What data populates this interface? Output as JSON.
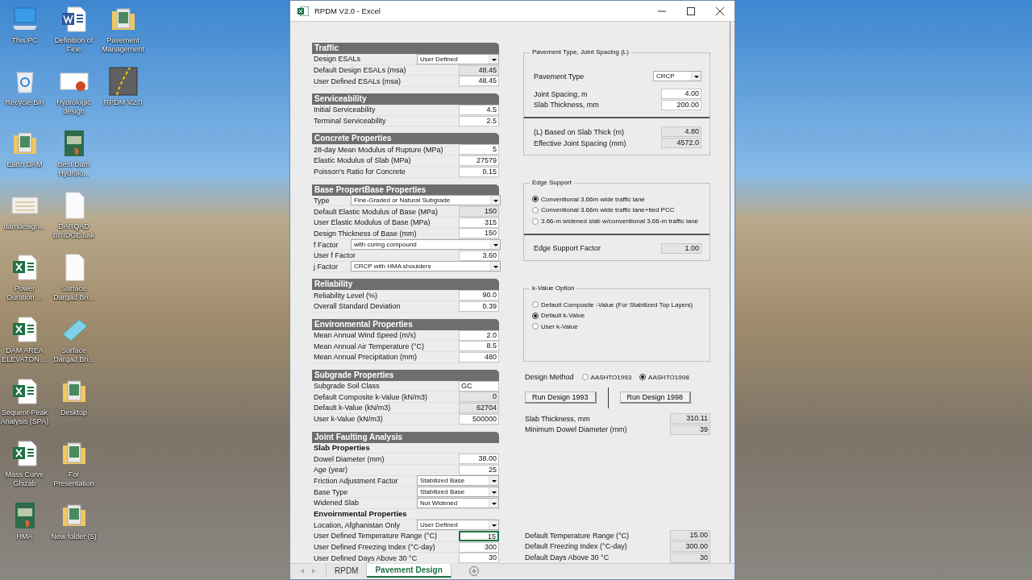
{
  "desktop": {
    "icons": [
      {
        "label": "This PC",
        "kind": "computer"
      },
      {
        "label": "Recycle Bin",
        "kind": "bin"
      },
      {
        "label": "Earth DAM",
        "kind": "folder"
      },
      {
        "label": "damdesign...",
        "kind": "sheet-image"
      },
      {
        "label": "Power Duration ...",
        "kind": "excel"
      },
      {
        "label": "DAM AREA ELEVATON ...",
        "kind": "excel"
      },
      {
        "label": "Sequent-Peak Analysis (SPA)",
        "kind": "excel"
      },
      {
        "label": "Mass Curve Ghizab",
        "kind": "excel"
      },
      {
        "label": "HMA",
        "kind": "book"
      },
      {
        "label": "Definition of Fine",
        "kind": "word"
      },
      {
        "label": "Hydrologic design",
        "kind": "slides"
      },
      {
        "label": "Best Dam Hydrolo...",
        "kind": "book"
      },
      {
        "label": "DARQAD BRIDGE.bak",
        "kind": "file"
      },
      {
        "label": "Surface Darqad Bri...",
        "kind": "file"
      },
      {
        "label": "Surface Darqad Bri...",
        "kind": "notepad"
      },
      {
        "label": "Desktop",
        "kind": "folder"
      },
      {
        "label": "For Presentation",
        "kind": "folder"
      },
      {
        "label": "New folder (5)",
        "kind": "folder"
      },
      {
        "label": "Pavement Management",
        "kind": "folder"
      },
      {
        "label": "RPDM V2.0",
        "kind": "road"
      }
    ]
  },
  "window": {
    "title": "RPDM V2.0 - Excel",
    "left_sections": [
      {
        "title": "Traffic",
        "rows": [
          {
            "kind": "select",
            "label": "Design ESALs",
            "value": "User Defined"
          },
          {
            "kind": "computed",
            "label": "Default Design ESALs (msa)",
            "value": "48.45"
          },
          {
            "kind": "input",
            "label": "User Defined ESALs (msa)",
            "value": "48.45"
          }
        ]
      },
      {
        "title": "Serviceability",
        "rows": [
          {
            "kind": "input",
            "label": "Initial Serviceability",
            "value": "4.5"
          },
          {
            "kind": "input",
            "label": "Terminal Serviceability",
            "value": "2.5"
          }
        ]
      },
      {
        "title": "Concrete Properties",
        "rows": [
          {
            "kind": "input",
            "label": "28-day Mean Modulus of Rupture (MPa)",
            "value": "5"
          },
          {
            "kind": "input",
            "label": "Elastic Modulus of Slab (MPa)",
            "value": "27579"
          },
          {
            "kind": "input",
            "label": "Poisson's Ratio for Concrete",
            "value": "0.15"
          }
        ]
      },
      {
        "title": "Base PropertBase Properties",
        "rows": [
          {
            "kind": "select-wide",
            "label": "Type",
            "value": "Fine-Graded or Natural Subgrade"
          },
          {
            "kind": "computed",
            "label": "Default Elastic Modulus of Base (MPa)",
            "value": "150"
          },
          {
            "kind": "input",
            "label": "User Elastic Modulus of Base (MPa)",
            "value": "315"
          },
          {
            "kind": "input",
            "label": "Design Thickness of Base (mm)",
            "value": "150"
          },
          {
            "kind": "select-wide",
            "label": "f Factor",
            "value": "with curing compound"
          },
          {
            "kind": "input",
            "label": "User f Factor",
            "value": "3.60"
          },
          {
            "kind": "select-wide",
            "label": "j Factor",
            "value": "CRCP with HMA shoulders"
          }
        ]
      },
      {
        "title": "Reliability",
        "rows": [
          {
            "kind": "input",
            "label": "Reliability Level (%)",
            "value": "90.0"
          },
          {
            "kind": "input",
            "label": "Overall Standard Deviation",
            "value": "0.39"
          }
        ]
      },
      {
        "title": "Environmental Properties",
        "rows": [
          {
            "kind": "input",
            "label": "Mean Annual Wind Speed (m/s)",
            "value": "2.0"
          },
          {
            "kind": "input",
            "label": "Mean Annual Air Temperature (°C)",
            "value": "8.5"
          },
          {
            "kind": "input",
            "label": "Mean Annual Precipitation (mm)",
            "value": "480"
          }
        ]
      },
      {
        "title": "Subgrade Properties",
        "rows": [
          {
            "kind": "text-input",
            "label": "Subgrade Soil Class",
            "value": "GC"
          },
          {
            "kind": "computed",
            "label": "Default Composite k-Value (kN/m3)",
            "value": "0"
          },
          {
            "kind": "computed",
            "label": "Default k-Value (kN/m3)",
            "value": "62704"
          },
          {
            "kind": "input",
            "label": "User k-Value (kN/m3)",
            "value": "500000"
          }
        ]
      },
      {
        "title": "Joint Faulting Analysis",
        "rows": [
          {
            "kind": "subheader",
            "label": "Slab Properties"
          },
          {
            "kind": "input",
            "label": "Dowel Diameter (mm)",
            "value": "38.00"
          },
          {
            "kind": "input",
            "label": "Age (year)",
            "value": "25"
          },
          {
            "kind": "select",
            "label": "Friction Adjustment Factor",
            "value": "Stabilized Base"
          },
          {
            "kind": "select",
            "label": "Base Type",
            "value": "Stabilized Base"
          },
          {
            "kind": "select",
            "label": "Widened Slab",
            "value": "Not Widened"
          },
          {
            "kind": "subheader",
            "label": "Envoirnmental Properties"
          },
          {
            "kind": "select",
            "label": "Location, Afghanistan Only",
            "value": "User Defined"
          },
          {
            "kind": "input",
            "label": "User Defined Temperature Range (°C)",
            "value": "15",
            "active": true
          },
          {
            "kind": "input",
            "label": "User Defined Freezing Index (°C-day)",
            "value": "300"
          },
          {
            "kind": "input",
            "label": "User Defined Days Above 30 °C",
            "value": "30"
          }
        ]
      }
    ],
    "right_groups": [
      {
        "title": "Pavement Type, Joint Spacing (L)",
        "items": [
          {
            "kind": "select",
            "label": "Pavement Type",
            "value": "CRCP"
          },
          {
            "kind": "input",
            "label": "Joint Spacing, m",
            "value": "4.00"
          },
          {
            "kind": "input",
            "label": "Slab Thickness, mm",
            "value": "200.00"
          }
        ],
        "results": [
          {
            "label": "(L) Based on Slab Thick (m)",
            "value": "4.80"
          },
          {
            "label": "Effective Joint Spacing (mm)",
            "value": "4572.0"
          }
        ]
      },
      {
        "title": "Edge Support",
        "items": [
          {
            "kind": "radio",
            "label": "Conventional 3.66m wide traffic lane",
            "selected": true
          },
          {
            "kind": "radio",
            "label": "Conventional 3.66m wide traffic lane+tied PCC",
            "selected": false
          },
          {
            "kind": "radio",
            "label": "3.66-m widened slab w/conventional 3.66-m traffic lane",
            "selected": false
          }
        ],
        "results": [
          {
            "label": "Edge Support Factor",
            "value": "1.00"
          }
        ]
      },
      {
        "title": "k-Value Option",
        "items": [
          {
            "kind": "radio",
            "label": "Default Composite -Value  (For Stabilized Top Layers)",
            "selected": false
          },
          {
            "kind": "radio",
            "label": "Default k-Value",
            "selected": true
          },
          {
            "kind": "radio",
            "label": "User k-Value",
            "selected": false
          }
        ]
      }
    ],
    "design_method": {
      "label": "Design Method",
      "options": [
        {
          "label": "AASHTO1993",
          "selected": false
        },
        {
          "label": "AASHTO1998",
          "selected": true
        }
      ]
    },
    "buttons": [
      "Run Design 1993",
      "Run Design 1998"
    ],
    "results": [
      {
        "label": "Slab Thickness, mm",
        "value": "310.11"
      },
      {
        "label": "Minimum Dowel Diameter (mm)",
        "value": "39"
      }
    ],
    "default_results": [
      {
        "label": "Default Temperature Range (°C)",
        "value": "15.00"
      },
      {
        "label": "Default Freezing Index (°C-day)",
        "value": "300.00"
      },
      {
        "label": "Default Days Above 30 °C",
        "value": "30"
      }
    ],
    "sheet_tabs": [
      {
        "label": "RPDM",
        "selected": false
      },
      {
        "label": "Pavement Design",
        "selected": true
      }
    ]
  }
}
